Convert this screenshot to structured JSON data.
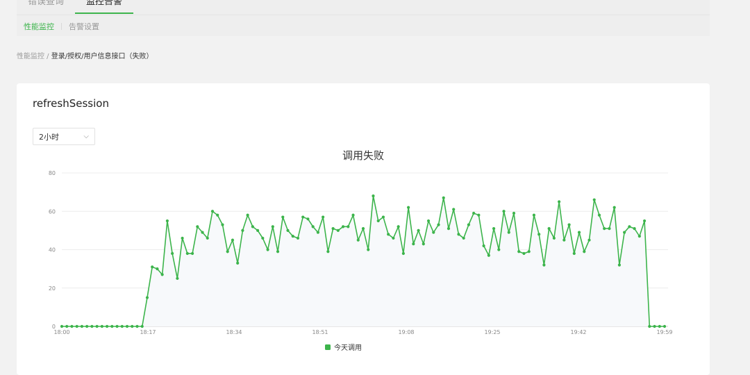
{
  "nav": {
    "main_tabs": [
      "错误查询",
      "监控告警"
    ],
    "sub_tabs": [
      "性能监控",
      "告警设置"
    ]
  },
  "breadcrumb": {
    "root": "性能监控 /",
    "current": "登录/授权/用户信息接口（失败）"
  },
  "card": {
    "title": "refreshSession"
  },
  "range_select": {
    "value": "2小时"
  },
  "chart_data": {
    "type": "line",
    "title": "调用失败",
    "x_tick_labels": [
      "18:00",
      "18:17",
      "18:34",
      "18:51",
      "19:08",
      "19:25",
      "19:42",
      "19:59"
    ],
    "ylim": [
      0,
      80
    ],
    "y_ticks": [
      0,
      20,
      40,
      60,
      80
    ],
    "grid": true,
    "legend_position": "bottom",
    "colors": {
      "series": "#3cb44b",
      "fill": "#f7f9fb",
      "grid": "#ececec"
    },
    "series": [
      {
        "name": "今天调用",
        "values": [
          0,
          0,
          0,
          0,
          0,
          0,
          0,
          0,
          0,
          0,
          0,
          0,
          0,
          0,
          0,
          0,
          0,
          15,
          31,
          30,
          27,
          55,
          38,
          25,
          46,
          38,
          38,
          52,
          49,
          46,
          60,
          58,
          53,
          39,
          45,
          33,
          50,
          58,
          52,
          50,
          46,
          40,
          52,
          39,
          57,
          50,
          47,
          46,
          57,
          56,
          52,
          49,
          57,
          39,
          51,
          50,
          52,
          52,
          58,
          45,
          51,
          40,
          68,
          55,
          57,
          48,
          46,
          52,
          38,
          62,
          43,
          50,
          43,
          55,
          49,
          53,
          67,
          51,
          61,
          48,
          46,
          53,
          59,
          58,
          42,
          37,
          51,
          40,
          60,
          49,
          59,
          39,
          38,
          39,
          58,
          48,
          32,
          51,
          46,
          65,
          45,
          53,
          38,
          49,
          39,
          45,
          66,
          58,
          51,
          51,
          62,
          32,
          49,
          52,
          51,
          47,
          55,
          0,
          0,
          0,
          0
        ]
      }
    ]
  }
}
